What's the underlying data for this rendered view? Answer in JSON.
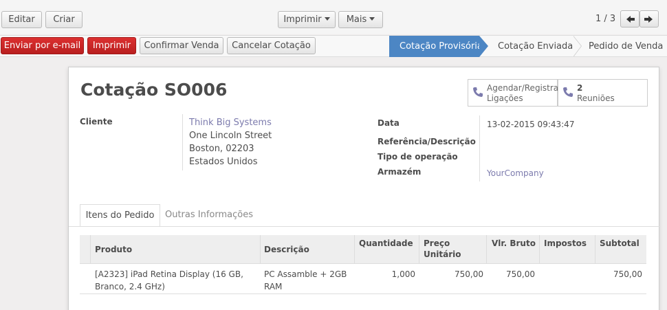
{
  "toolbar": {
    "edit_label": "Editar",
    "create_label": "Criar",
    "print_label": "Imprimir",
    "more_label": "Mais",
    "pager_text": "1 / 3"
  },
  "status_buttons": {
    "send_email": "Enviar por e-mail",
    "print": "Imprimir",
    "confirm_sale": "Confirmar Venda",
    "cancel_quote": "Cancelar Cotação"
  },
  "stages": {
    "draft": "Cotação Provisória",
    "sent": "Cotação Enviada",
    "sale": "Pedido de Venda",
    "active": "draft",
    "active_color": "#4c86c4"
  },
  "form": {
    "title": "Cotação SO006",
    "smart_calls_line1": "Agendar/Registrar",
    "smart_calls_line2": "Ligações",
    "smart_meetings_count": "2",
    "smart_meetings_label": "Reuniões",
    "customer_label": "Cliente",
    "customer_name": "Think Big Systems",
    "customer_street": "One Lincoln Street",
    "customer_city": "Boston, 02203",
    "customer_country": "Estados Unidos",
    "date_label": "Data",
    "date_value": "13-02-2015 09:43:47",
    "reference_label": "Referência/Descrição",
    "operation_type_label": "Tipo de operação",
    "warehouse_label": "Armazém",
    "warehouse_value": "YourCompany"
  },
  "tabs": {
    "order_lines": "Itens do Pedido",
    "other_info": "Outras Informações"
  },
  "table": {
    "headers": {
      "product": "Produto",
      "description": "Descrição",
      "quantity": "Quantidade",
      "unit_price_line1": "Preço",
      "unit_price_line2": "Unitário",
      "gross": "Vlr. Bruto",
      "taxes": "Impostos",
      "subtotal": "Subtotal"
    },
    "rows": [
      {
        "product_line1": "[A2323] iPad Retina Display (16 GB,",
        "product_line2": "Branco, 2.4 GHz)",
        "description_line1": "PC Assamble + 2GB",
        "description_line2": "RAM",
        "quantity": "1,000",
        "unit_price": "750,00",
        "gross": "750,00",
        "taxes": "",
        "subtotal": "750,00"
      }
    ]
  }
}
